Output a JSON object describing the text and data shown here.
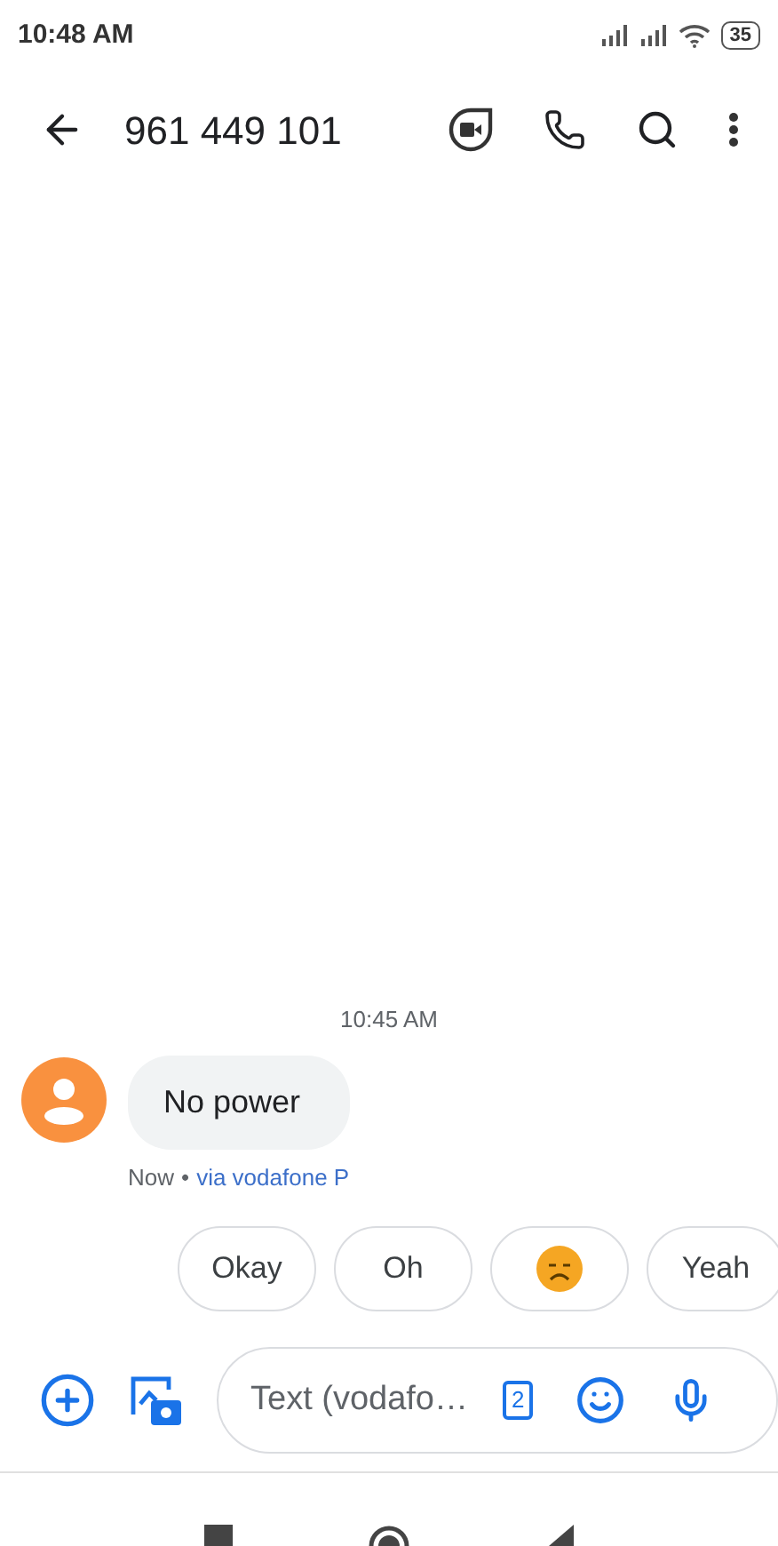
{
  "status_bar": {
    "time": "10:48 AM",
    "battery": "35"
  },
  "header": {
    "title": "961 449 101"
  },
  "conversation": {
    "timestamp": "10:45 AM",
    "messages": [
      {
        "text": "No power",
        "time": "Now",
        "separator": "•",
        "via": "via vodafone P"
      }
    ]
  },
  "smart_replies": [
    {
      "kind": "text",
      "label": "Okay"
    },
    {
      "kind": "text",
      "label": "Oh"
    },
    {
      "kind": "emoji"
    },
    {
      "kind": "text",
      "label": "Yeah"
    }
  ],
  "compose": {
    "placeholder": "Text (vodafo…",
    "sim": "2"
  }
}
